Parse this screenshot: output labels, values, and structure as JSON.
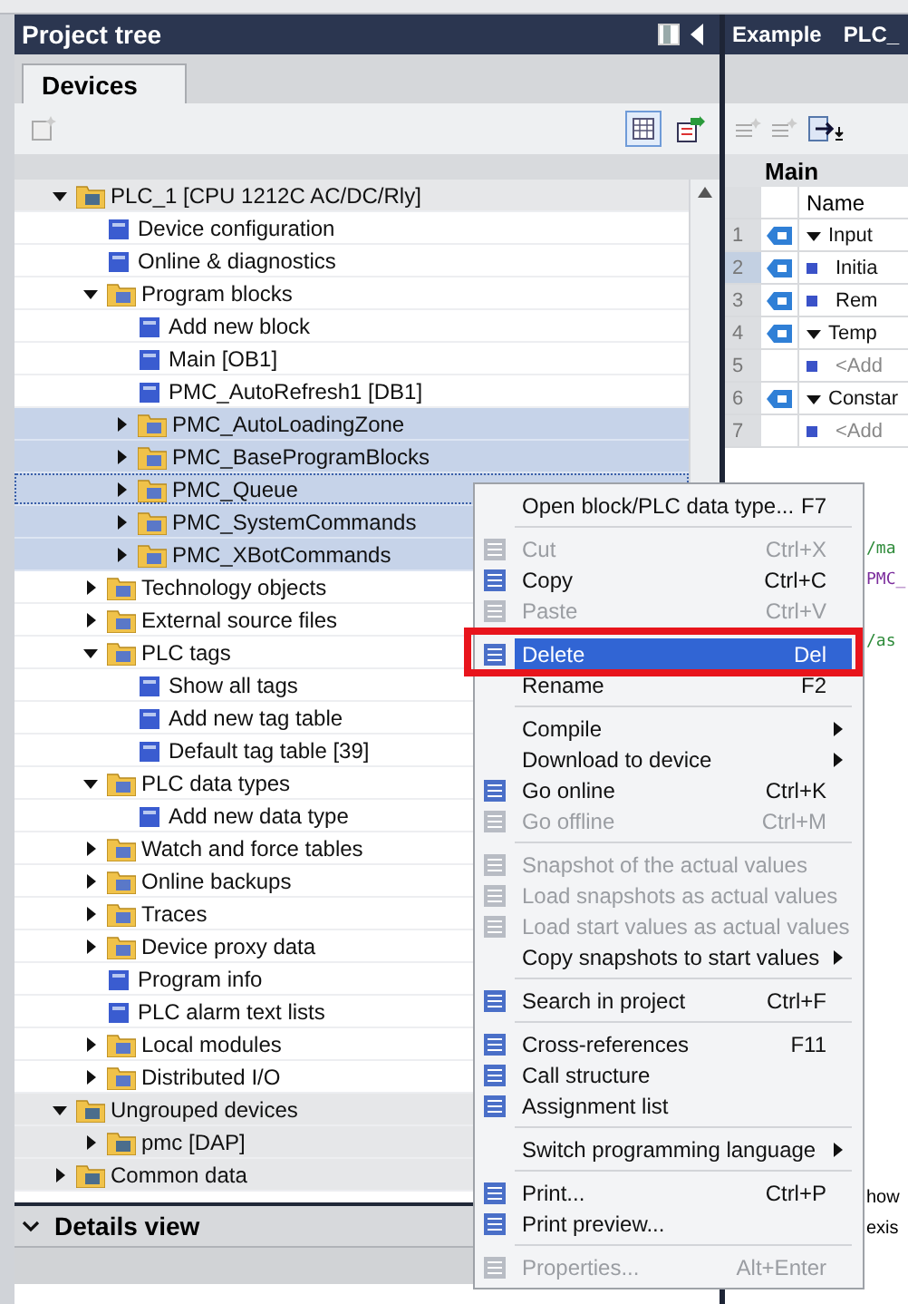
{
  "project_tree": {
    "title": "Project tree",
    "tab": {
      "label": "Devices",
      "selected": true
    },
    "items": [
      {
        "label": "PLC_1 [CPU 1212C AC/DC/Rly]",
        "kind": "device",
        "expanded": true,
        "selected": false,
        "children": [
          {
            "label": "Device configuration",
            "kind": "item",
            "selected": false
          },
          {
            "label": "Online & diagnostics",
            "kind": "item",
            "selected": false
          },
          {
            "label": "Program blocks",
            "kind": "folder",
            "expanded": true,
            "selected": false,
            "children": [
              {
                "label": "Add new block",
                "kind": "item",
                "selected": false
              },
              {
                "label": "Main [OB1]",
                "kind": "item",
                "selected": false
              },
              {
                "label": "PMC_AutoRefresh1 [DB1]",
                "kind": "item",
                "selected": false
              },
              {
                "label": "PMC_AutoLoadingZone",
                "kind": "folder",
                "expanded": false,
                "selected": true
              },
              {
                "label": "PMC_BaseProgramBlocks",
                "kind": "folder",
                "expanded": false,
                "selected": true
              },
              {
                "label": "PMC_Queue",
                "kind": "folder",
                "expanded": false,
                "selected": true,
                "focused": true
              },
              {
                "label": "PMC_SystemCommands",
                "kind": "folder",
                "expanded": false,
                "selected": true
              },
              {
                "label": "PMC_XBotCommands",
                "kind": "folder",
                "expanded": false,
                "selected": true
              }
            ]
          },
          {
            "label": "Technology objects",
            "kind": "folder",
            "expanded": false,
            "selected": false
          },
          {
            "label": "External source files",
            "kind": "folder",
            "expanded": false,
            "selected": false
          },
          {
            "label": "PLC tags",
            "kind": "folder",
            "expanded": true,
            "selected": false,
            "children": [
              {
                "label": "Show all tags",
                "kind": "item",
                "selected": false
              },
              {
                "label": "Add new tag table",
                "kind": "item",
                "selected": false
              },
              {
                "label": "Default tag table [39]",
                "kind": "item",
                "selected": false
              }
            ]
          },
          {
            "label": "PLC data types",
            "kind": "folder",
            "expanded": true,
            "selected": false,
            "children": [
              {
                "label": "Add new data type",
                "kind": "item",
                "selected": false
              }
            ]
          },
          {
            "label": "Watch and force tables",
            "kind": "folder",
            "expanded": false,
            "selected": false
          },
          {
            "label": "Online backups",
            "kind": "folder",
            "expanded": false,
            "selected": false
          },
          {
            "label": "Traces",
            "kind": "folder",
            "expanded": false,
            "selected": false
          },
          {
            "label": "Device proxy data",
            "kind": "folder",
            "expanded": false,
            "selected": false
          },
          {
            "label": "Program info",
            "kind": "item",
            "selected": false
          },
          {
            "label": "PLC alarm text lists",
            "kind": "item",
            "selected": false
          },
          {
            "label": "Local modules",
            "kind": "folder",
            "expanded": false,
            "selected": false
          },
          {
            "label": "Distributed I/O",
            "kind": "folder",
            "expanded": false,
            "selected": false
          }
        ]
      },
      {
        "label": "Ungrouped devices",
        "kind": "device",
        "expanded": true,
        "selected": false,
        "children": [
          {
            "label": "pmc [DAP]",
            "kind": "device",
            "expanded": false,
            "selected": false
          }
        ]
      },
      {
        "label": "Common data",
        "kind": "device",
        "expanded": false,
        "selected": false
      }
    ],
    "details_view": {
      "label": "Details view",
      "expanded": false
    }
  },
  "editor": {
    "breadcrumb": [
      "Example",
      "PLC_"
    ],
    "block_title": "Main",
    "name_column": "Name",
    "rows": [
      {
        "number": "1",
        "kind": "section",
        "name": "Input",
        "selected": false
      },
      {
        "number": "2",
        "kind": "member",
        "name": "Initia",
        "selected": true
      },
      {
        "number": "3",
        "kind": "member",
        "name": "Rem",
        "selected": false
      },
      {
        "number": "4",
        "kind": "section",
        "name": "Temp",
        "selected": false
      },
      {
        "number": "5",
        "kind": "add",
        "name": "<Add",
        "selected": false
      },
      {
        "number": "6",
        "kind": "section",
        "name": "Constar",
        "selected": false
      },
      {
        "number": "7",
        "kind": "add",
        "name": "<Add",
        "selected": false
      }
    ],
    "code_lines": [
      {
        "text": "/ma",
        "color": "#2e8b3a"
      },
      {
        "text": "PMC_",
        "color": "#7b2c9c"
      },
      {
        "text": "/as",
        "color": "#2e8b3a"
      }
    ],
    "bottom_texts": [
      "how",
      "exis"
    ]
  },
  "context_menu": {
    "items": [
      {
        "kind": "item",
        "label": "Open block/PLC data type...",
        "shortcut": "F7",
        "disabled": false,
        "submenu": false,
        "has_icon": false,
        "selected": false
      },
      {
        "kind": "separator"
      },
      {
        "kind": "item",
        "label": "Cut",
        "shortcut": "Ctrl+X",
        "disabled": true,
        "submenu": false,
        "has_icon": true,
        "selected": false
      },
      {
        "kind": "item",
        "label": "Copy",
        "shortcut": "Ctrl+C",
        "disabled": false,
        "submenu": false,
        "has_icon": true,
        "selected": false
      },
      {
        "kind": "item",
        "label": "Paste",
        "shortcut": "Ctrl+V",
        "disabled": true,
        "submenu": false,
        "has_icon": true,
        "selected": false
      },
      {
        "kind": "separator"
      },
      {
        "kind": "item",
        "label": "Delete",
        "shortcut": "Del",
        "disabled": false,
        "submenu": false,
        "has_icon": true,
        "selected": true,
        "outlined": true
      },
      {
        "kind": "item",
        "label": "Rename",
        "shortcut": "F2",
        "disabled": false,
        "submenu": false,
        "has_icon": false,
        "selected": false
      },
      {
        "kind": "separator"
      },
      {
        "kind": "item",
        "label": "Compile",
        "disabled": false,
        "submenu": true,
        "has_icon": false,
        "selected": false
      },
      {
        "kind": "item",
        "label": "Download to device",
        "disabled": false,
        "submenu": true,
        "has_icon": false,
        "selected": false
      },
      {
        "kind": "item",
        "label": "Go online",
        "shortcut": "Ctrl+K",
        "disabled": false,
        "submenu": false,
        "has_icon": true,
        "selected": false
      },
      {
        "kind": "item",
        "label": "Go offline",
        "shortcut": "Ctrl+M",
        "disabled": true,
        "submenu": false,
        "has_icon": true,
        "selected": false
      },
      {
        "kind": "separator"
      },
      {
        "kind": "item",
        "label": "Snapshot of the actual values",
        "disabled": true,
        "submenu": false,
        "has_icon": true,
        "selected": false
      },
      {
        "kind": "item",
        "label": "Load snapshots as actual values",
        "disabled": true,
        "submenu": false,
        "has_icon": true,
        "selected": false
      },
      {
        "kind": "item",
        "label": "Load start values as actual values",
        "disabled": true,
        "submenu": false,
        "has_icon": true,
        "selected": false
      },
      {
        "kind": "item",
        "label": "Copy snapshots to start values",
        "disabled": false,
        "submenu": true,
        "has_icon": false,
        "selected": false
      },
      {
        "kind": "separator"
      },
      {
        "kind": "item",
        "label": "Search in project",
        "shortcut": "Ctrl+F",
        "disabled": false,
        "submenu": false,
        "has_icon": true,
        "selected": false
      },
      {
        "kind": "separator"
      },
      {
        "kind": "item",
        "label": "Cross-references",
        "shortcut": "F11",
        "disabled": false,
        "submenu": false,
        "has_icon": true,
        "selected": false
      },
      {
        "kind": "item",
        "label": "Call structure",
        "disabled": false,
        "submenu": false,
        "has_icon": true,
        "selected": false
      },
      {
        "kind": "item",
        "label": "Assignment list",
        "disabled": false,
        "submenu": false,
        "has_icon": true,
        "selected": false
      },
      {
        "kind": "separator"
      },
      {
        "kind": "item",
        "label": "Switch programming language",
        "disabled": false,
        "submenu": true,
        "has_icon": false,
        "selected": false
      },
      {
        "kind": "separator"
      },
      {
        "kind": "item",
        "label": "Print...",
        "shortcut": "Ctrl+P",
        "disabled": false,
        "submenu": false,
        "has_icon": true,
        "selected": false
      },
      {
        "kind": "item",
        "label": "Print preview...",
        "disabled": false,
        "submenu": false,
        "has_icon": true,
        "selected": false
      },
      {
        "kind": "separator"
      },
      {
        "kind": "item",
        "label": "Properties...",
        "shortcut": "Alt+Enter",
        "disabled": true,
        "submenu": false,
        "has_icon": true,
        "selected": false
      }
    ]
  }
}
